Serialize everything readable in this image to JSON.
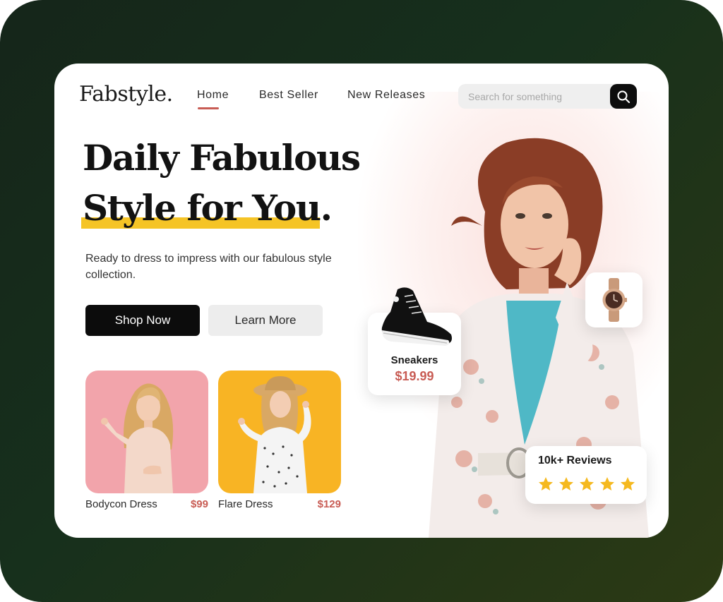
{
  "brand": {
    "logo": "Fabstyle."
  },
  "nav": {
    "items": [
      {
        "label": "Home",
        "active": true
      },
      {
        "label": "Best Seller",
        "active": false
      },
      {
        "label": "New Releases",
        "active": false
      }
    ]
  },
  "search": {
    "placeholder": "Search for something",
    "icon": "search-icon"
  },
  "hero": {
    "title_line1": "Daily Fabulous",
    "title_line2": "Style for You.",
    "description": "Ready to dress to impress with our fabulous style collection.",
    "primary_button": "Shop Now",
    "secondary_button": "Learn More"
  },
  "products": [
    {
      "name": "Bodycon Dress",
      "price": "$99",
      "bg_color": "#f2a4ab"
    },
    {
      "name": "Flare Dress",
      "price": "$129",
      "bg_color": "#f8b424"
    }
  ],
  "floating": {
    "sneakers": {
      "name": "Sneakers",
      "price": "$19.99"
    },
    "watch": {
      "icon": "watch-icon"
    },
    "reviews": {
      "label": "10k+ Reviews",
      "rating": 5,
      "max_rating": 5
    }
  },
  "colors": {
    "accent": "#c85c54",
    "highlight": "#f5c426",
    "primary_button": "#0c0c0c",
    "star": "#f5b91f",
    "frame_bg": "#17301c"
  }
}
